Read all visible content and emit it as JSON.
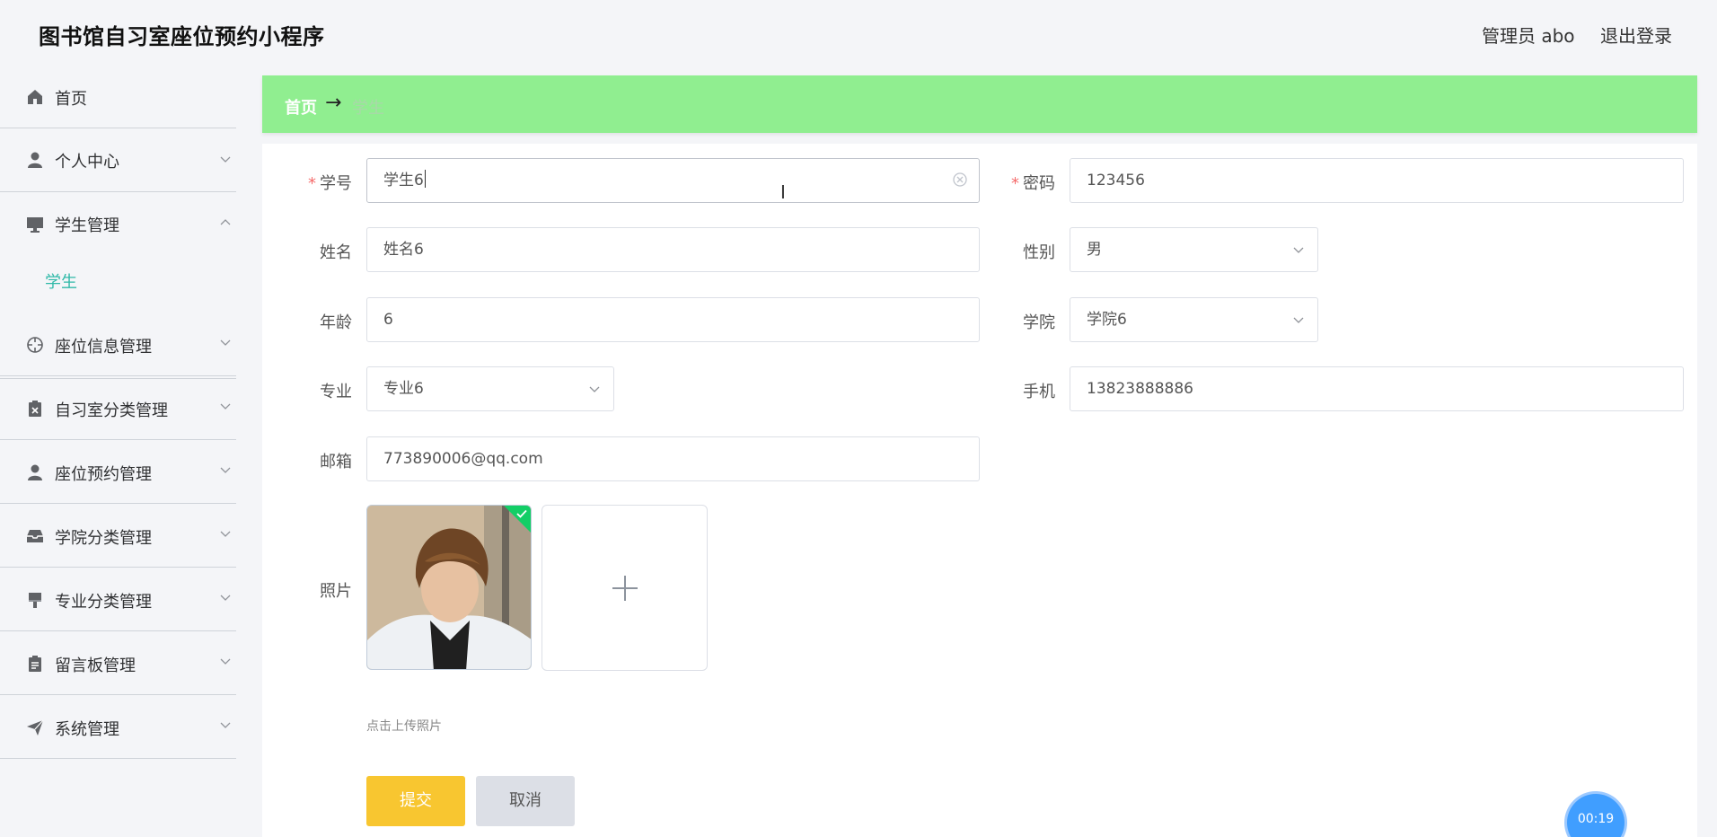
{
  "header": {
    "app_title": "图书馆自习室座位预约小程序",
    "user_label": "管理员 abo",
    "logout_label": "退出登录"
  },
  "sidebar": {
    "items": [
      {
        "label": "首页",
        "icon": "home-icon",
        "expanded": false
      },
      {
        "label": "个人中心",
        "icon": "user-icon",
        "expanded": false
      },
      {
        "label": "学生管理",
        "icon": "monitor-icon",
        "expanded": true
      },
      {
        "label": "座位信息管理",
        "icon": "target-icon",
        "expanded": false
      },
      {
        "label": "自习室分类管理",
        "icon": "clipboard-x-icon",
        "expanded": false
      },
      {
        "label": "座位预约管理",
        "icon": "user-icon",
        "expanded": false
      },
      {
        "label": "学院分类管理",
        "icon": "tray-icon",
        "expanded": false
      },
      {
        "label": "专业分类管理",
        "icon": "brush-icon",
        "expanded": false
      },
      {
        "label": "留言板管理",
        "icon": "clipboard-icon",
        "expanded": false
      },
      {
        "label": "系统管理",
        "icon": "send-icon",
        "expanded": false
      }
    ],
    "subitem_active": "学生"
  },
  "breadcrumb": {
    "home": "首页",
    "separator": "→",
    "current": "学生"
  },
  "form": {
    "student_id": {
      "label": "学号",
      "value": "学生6",
      "required": true
    },
    "password": {
      "label": "密码",
      "value": "123456",
      "required": true
    },
    "name": {
      "label": "姓名",
      "value": "姓名6"
    },
    "gender": {
      "label": "性别",
      "value": "男"
    },
    "age": {
      "label": "年龄",
      "value": "6"
    },
    "college": {
      "label": "学院",
      "value": "学院6"
    },
    "major": {
      "label": "专业",
      "value": "专业6"
    },
    "phone": {
      "label": "手机",
      "value": "13823888886"
    },
    "email": {
      "label": "邮箱",
      "value": "773890006@qq.com"
    },
    "photo": {
      "label": "照片",
      "tip": "点击上传照片",
      "uploaded": true
    }
  },
  "actions": {
    "submit_label": "提交",
    "cancel_label": "取消"
  },
  "timer": {
    "label": "00:19"
  },
  "colors": {
    "breadcrumb_bg": "#90ee90",
    "active_sub": "#2fb9a8",
    "submit_bg": "#f8c630",
    "cancel_bg": "#dcdfe6",
    "required": "#f56c6c",
    "upload_success": "#13ce66",
    "timer_bg": "#409eff"
  }
}
